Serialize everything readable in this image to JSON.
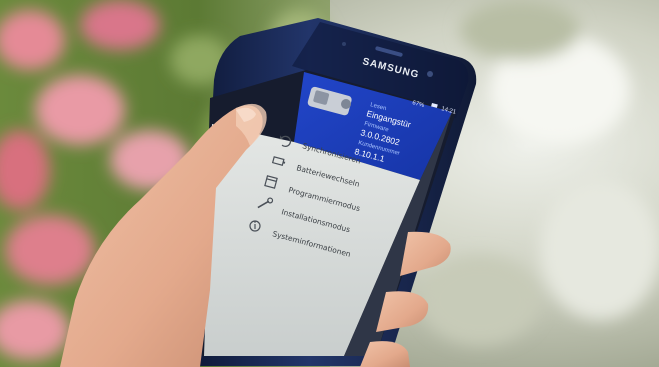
{
  "phone": {
    "brand": "SAMSUNG"
  },
  "status_bar": {
    "battery": "67%",
    "time": "14:21"
  },
  "device_header": {
    "name_label": "Lesen",
    "name_value": "Eingangstür",
    "firmware_label": "Firmware",
    "firmware_value": "3.0.0.2802",
    "serial_label": "Kundennummer",
    "serial_value": "8.10.1.1"
  },
  "menu": {
    "items": [
      {
        "label": "Synchronisieren",
        "icon": "sync-icon"
      },
      {
        "label": "Batteriewechseln",
        "icon": "battery-icon"
      },
      {
        "label": "Programmiermodus",
        "icon": "calendar-icon"
      },
      {
        "label": "Installationsmodus",
        "icon": "wrench-icon"
      },
      {
        "label": "Systeminformationen",
        "icon": "info-icon"
      }
    ]
  },
  "colors": {
    "phone_body": "#1c2a52",
    "header_blue": "#1e3fbf",
    "drawer_bg": "#dfe3e2",
    "skin": "#e8b196"
  }
}
